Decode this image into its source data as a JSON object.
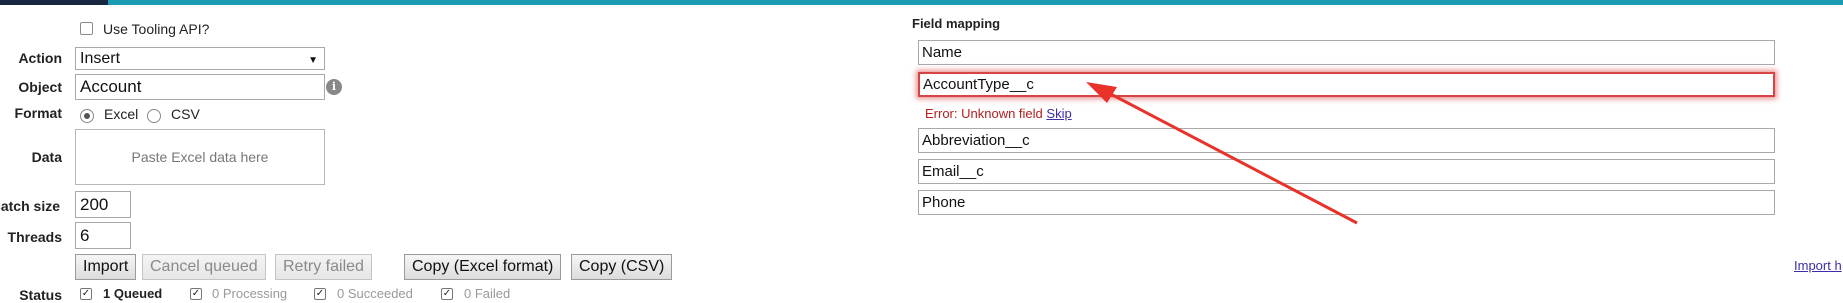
{
  "tooling": {
    "label": "Use Tooling API?"
  },
  "form": {
    "action_label": "Action",
    "action_value": "Insert",
    "object_label": "Object",
    "object_value": "Account",
    "format_label": "Format",
    "format_options": [
      "Excel",
      "CSV"
    ],
    "format_selected": "Excel",
    "data_label": "Data",
    "data_placeholder": "Paste Excel data here",
    "batch_label": "Batch size",
    "batch_value": "200",
    "threads_label": "Threads",
    "threads_value": "6",
    "status_label": "Status"
  },
  "buttons": {
    "import": "Import",
    "cancel": "Cancel queued",
    "retry": "Retry failed",
    "copy_excel": "Copy (Excel format)",
    "copy_csv": "Copy (CSV)"
  },
  "status": {
    "queued": "1 Queued",
    "processing": "0 Processing",
    "succeeded": "0 Succeeded",
    "failed": "0 Failed"
  },
  "mapping": {
    "title": "Field mapping",
    "fields": [
      "Name",
      "AccountType__c",
      "Abbreviation__c",
      "Email__c",
      "Phone"
    ],
    "error_text": "Error: Unknown field",
    "skip_label": "Skip",
    "import_help": "Import h"
  },
  "colors": {
    "top_bar": "#1b9ab4",
    "error": "#b42020",
    "annotation_arrow": "#e8322a"
  },
  "icons": {
    "info": "info-icon",
    "dropdown": "chevron-down-icon"
  }
}
